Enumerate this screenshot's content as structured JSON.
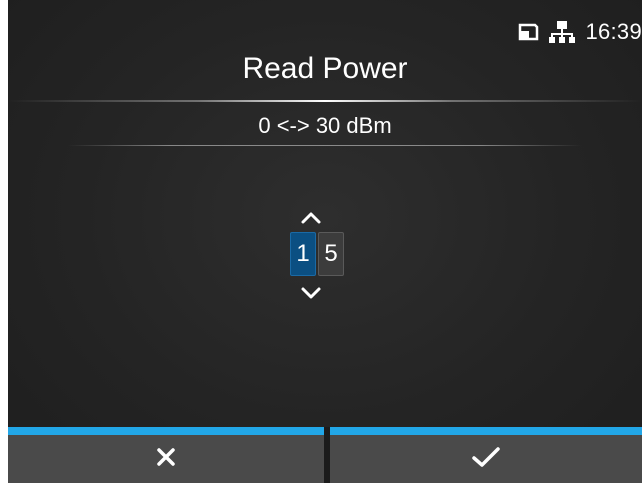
{
  "status_bar": {
    "time": "16:39",
    "icons": [
      "card-icon",
      "network-icon"
    ]
  },
  "screen": {
    "title": "Read Power",
    "range": "0 <-> 30 dBm"
  },
  "value_editor": {
    "digits": [
      "1",
      "5"
    ],
    "active_digit_index": 0,
    "icons": [
      "chevron-up-icon",
      "chevron-down-icon"
    ]
  },
  "softkeys": {
    "cancel_icon": "close-icon",
    "confirm_icon": "checkmark-icon",
    "accent_color": "#22a7e8"
  },
  "colors": {
    "active_digit": "#0b4f82",
    "inactive_digit": "#3c3c3c",
    "softkey_bg": "#4a4a4a"
  }
}
